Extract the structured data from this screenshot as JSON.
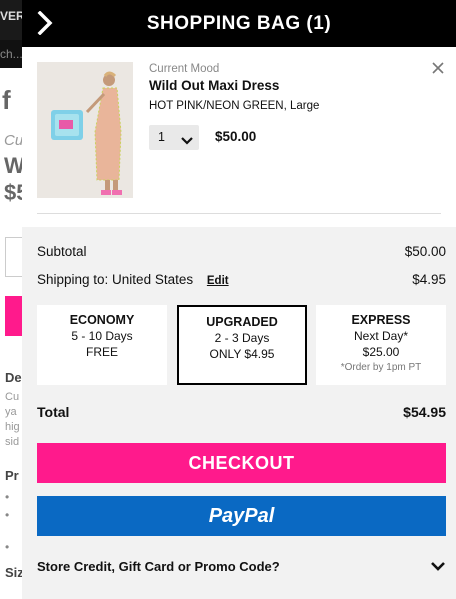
{
  "background": {
    "ver_text": "VER",
    "search_text": "ch...",
    "fb_text": "f",
    "cu_text": "Cu",
    "w_text": "W",
    "dollar_text": "$5",
    "de_text": "De",
    "lines": [
      "Cu",
      "ya",
      "hig",
      "sid"
    ],
    "pr_text": "Pr",
    "siz_text": "Siz"
  },
  "header": {
    "title": "SHOPPING BAG (1)",
    "back_icon": "chevron-right-icon"
  },
  "item": {
    "brand": "Current Mood",
    "name": "Wild Out Maxi Dress",
    "variant": "HOT PINK/NEON GREEN, Large",
    "quantity": "1",
    "price": "$50.00",
    "close_icon": "close-icon"
  },
  "summary": {
    "subtotal_label": "Subtotal",
    "subtotal_value": "$50.00",
    "shipping_label": "Shipping to: United States",
    "edit_label": "Edit",
    "shipping_value": "$4.95",
    "total_label": "Total",
    "total_value": "$54.95"
  },
  "shipping_options": [
    {
      "title": "ECONOMY",
      "line1": "5 - 10 Days",
      "line2": "FREE",
      "note": "",
      "selected": false
    },
    {
      "title": "UPGRADED",
      "line1": "2 - 3 Days",
      "line2": "ONLY $4.95",
      "note": "",
      "selected": true
    },
    {
      "title": "EXPRESS",
      "line1": "Next Day*",
      "line2": "$25.00",
      "note": "*Order by 1pm PT",
      "selected": false
    }
  ],
  "buttons": {
    "checkout": "CHECKOUT",
    "paypal": "PayPal"
  },
  "promo": {
    "label": "Store Credit, Gift Card or Promo Code?"
  },
  "colors": {
    "checkout": "#ff1a8c",
    "paypal": "#0a69c3",
    "header": "#000000"
  }
}
